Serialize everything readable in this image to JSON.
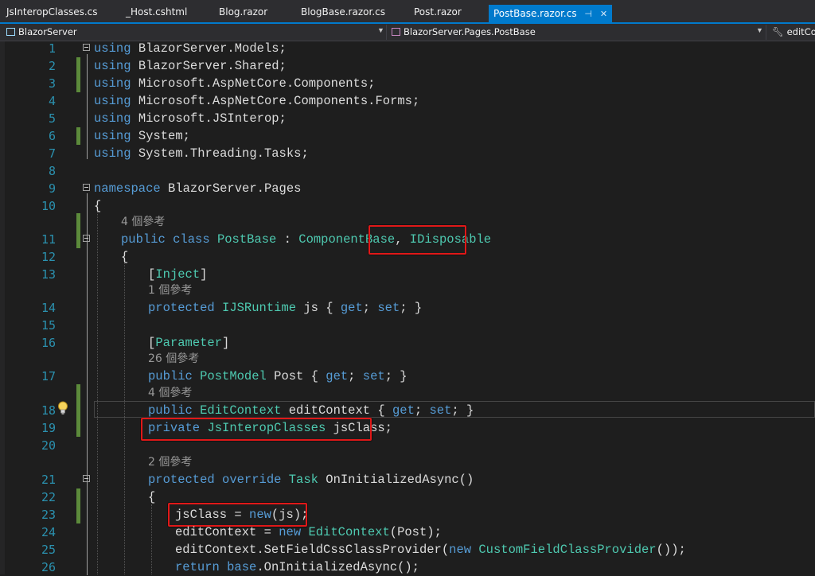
{
  "tabs": [
    {
      "label": "JsInteropClasses.cs",
      "active": false
    },
    {
      "label": "_Host.cshtml",
      "active": false
    },
    {
      "label": "Blog.razor",
      "active": false
    },
    {
      "label": "BlogBase.razor.cs",
      "active": false
    },
    {
      "label": "Post.razor",
      "active": false
    },
    {
      "label": "PostBase.razor.cs",
      "active": true
    }
  ],
  "tab_controls": {
    "pin": "⊣",
    "close": "✕"
  },
  "navbar": {
    "project": "BlazorServer",
    "type": "BlazorServer.Pages.PostBase",
    "member": "editCo"
  },
  "code_lines": [
    {
      "n": "1",
      "text": "using BlazorServer.Models;"
    },
    {
      "n": "2",
      "text": "using BlazorServer.Shared;"
    },
    {
      "n": "3",
      "text": "using Microsoft.AspNetCore.Components;"
    },
    {
      "n": "4",
      "text": "using Microsoft.AspNetCore.Components.Forms;"
    },
    {
      "n": "5",
      "text": "using Microsoft.JSInterop;"
    },
    {
      "n": "6",
      "text": "using System;"
    },
    {
      "n": "7",
      "text": "using System.Threading.Tasks;"
    },
    {
      "n": "8",
      "text": ""
    },
    {
      "n": "9",
      "text": "namespace BlazorServer.Pages"
    },
    {
      "n": "10",
      "text": "{"
    },
    {
      "n": "11",
      "text": "public class PostBase : ComponentBase, IDisposable"
    },
    {
      "n": "12",
      "text": "{"
    },
    {
      "n": "13",
      "text": "[Inject]"
    },
    {
      "n": "14",
      "text": "protected IJSRuntime js { get; set; }"
    },
    {
      "n": "15",
      "text": ""
    },
    {
      "n": "16",
      "text": "[Parameter]"
    },
    {
      "n": "17",
      "text": "public PostModel Post { get; set; }"
    },
    {
      "n": "18",
      "text": "public EditContext editContext { get; set; }"
    },
    {
      "n": "19",
      "text": "private JsInteropClasses jsClass;"
    },
    {
      "n": "20",
      "text": ""
    },
    {
      "n": "21",
      "text": "protected override Task OnInitializedAsync()"
    },
    {
      "n": "22",
      "text": "{"
    },
    {
      "n": "23",
      "text": "jsClass = new(js);"
    },
    {
      "n": "24",
      "text": "editContext = new EditContext(Post);"
    },
    {
      "n": "25",
      "text": "editContext.SetFieldCssClassProvider(new CustomFieldClassProvider());"
    },
    {
      "n": "26",
      "text": "return base.OnInitializedAsync();"
    }
  ],
  "references": [
    {
      "text": "4 個參考"
    },
    {
      "text": "1 個參考"
    },
    {
      "text": "26 個參考"
    },
    {
      "text": "4 個參考"
    },
    {
      "text": "2 個參考"
    }
  ],
  "colors": {
    "keyword": "#569cd6",
    "type": "#4ec9b0",
    "identifier": "#dcdcdc",
    "line_number": "#2b91af",
    "reference": "#999999",
    "change_bar": "#5c8a3b",
    "highlight_box": "#e01818",
    "active_tab": "#007acc"
  },
  "icons": {
    "lightbulb": "lightbulb-icon",
    "project": "csharp-project-icon",
    "class": "class-icon",
    "member": "wrench-icon"
  }
}
